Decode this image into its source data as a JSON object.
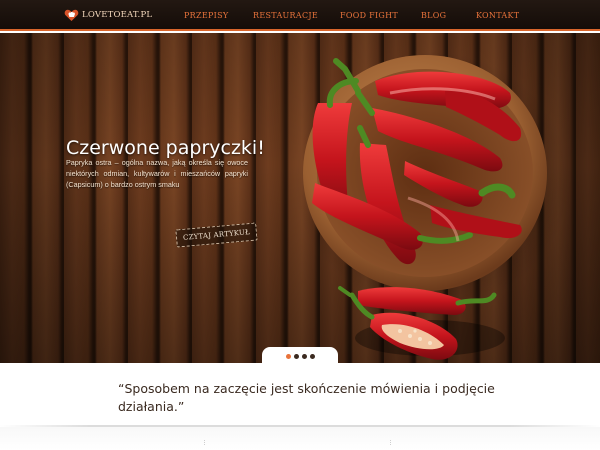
{
  "logo": {
    "text": "LOVETOEAT.PL",
    "icon": "heart-chef-hat-icon"
  },
  "nav": {
    "items": [
      {
        "label": "PRZEPISY"
      },
      {
        "label": "RESTAURACJE"
      },
      {
        "label": "FOOD FIGHT"
      },
      {
        "label": "BLOG"
      },
      {
        "label": "KONTAKT"
      }
    ]
  },
  "hero": {
    "title": "Czerwone papryczki!",
    "text": "Papryka ostra – ogólna nazwa, jaką określa się owoce niektórych odmian, kultywarów i mieszańców papryki (Capsicum) o bardzo ostrym smaku",
    "button_label": "CZYTAJ ARTYKUŁ",
    "slides_total": 4,
    "active_slide": 1
  },
  "quote": {
    "text": "“Sposobem na zaczęcie jest skończenie mówienia i podjęcie działania.”"
  },
  "colors": {
    "accent": "#e8733b",
    "navbar_bg": "#1a100b",
    "wood": "#6e3c1f",
    "chili_red": "#c4141c"
  }
}
